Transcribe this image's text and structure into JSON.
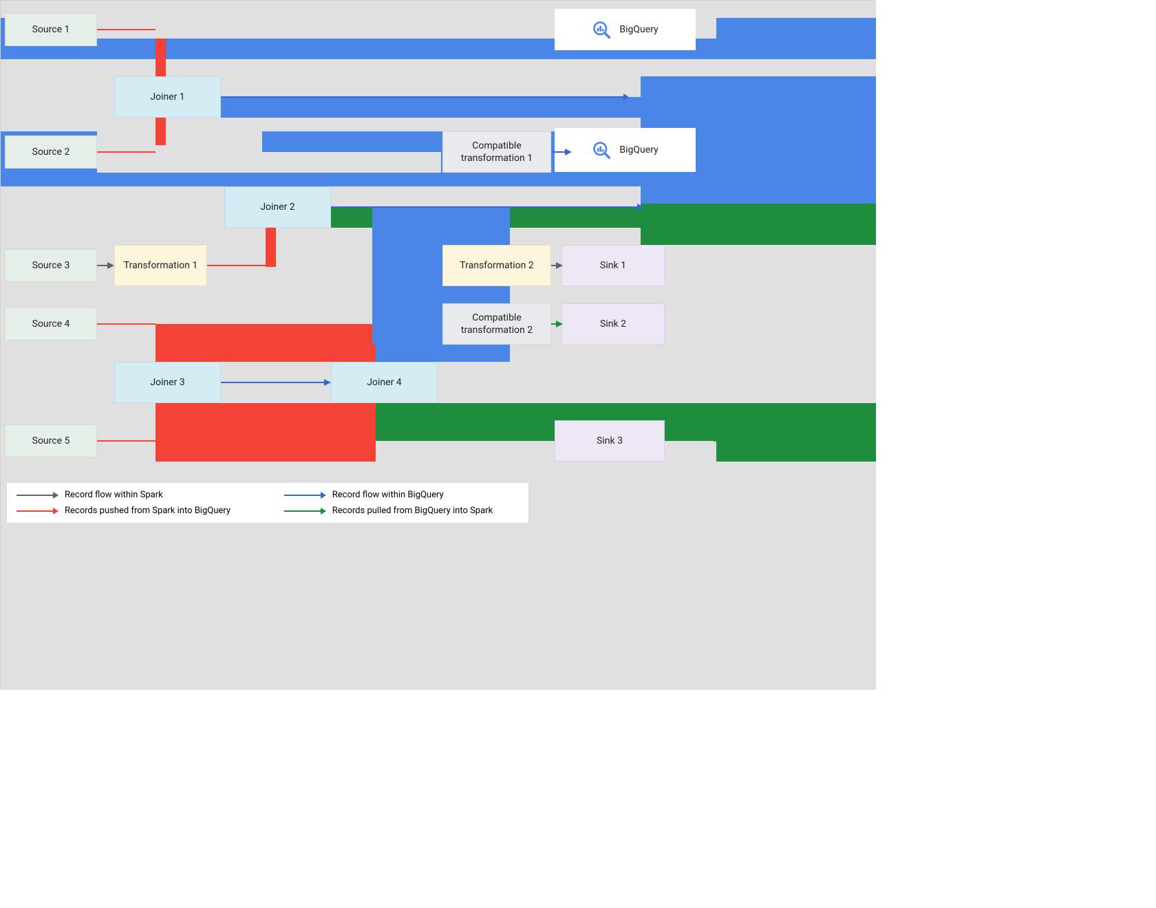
{
  "nodes": {
    "source1": "Source 1",
    "source2": "Source 2",
    "source3": "Source 3",
    "source4": "Source 4",
    "source5": "Source 5",
    "joiner1": "Joiner 1",
    "joiner2": "Joiner 2",
    "joiner3": "Joiner 3",
    "joiner4": "Joiner 4",
    "transform1": "Transformation 1",
    "transform2": "Transformation 2",
    "compat1": "Compatible transformation 1",
    "compat2": "Compatible transformation 2",
    "sink1": "Sink 1",
    "sink2": "Sink 2",
    "sink3": "Sink 3",
    "bigquery": "BigQuery"
  },
  "legend": {
    "within_spark": "Record flow within Spark",
    "within_bq": "Record flow within BigQuery",
    "push_to_bq": "Records pushed from Spark into BigQuery",
    "pull_from_bq": "Records pulled from BigQuery into Spark"
  },
  "colors": {
    "blue": "#4a86e8",
    "green": "#1e8e3e",
    "red": "#f44336",
    "gray": "#5f6368"
  }
}
